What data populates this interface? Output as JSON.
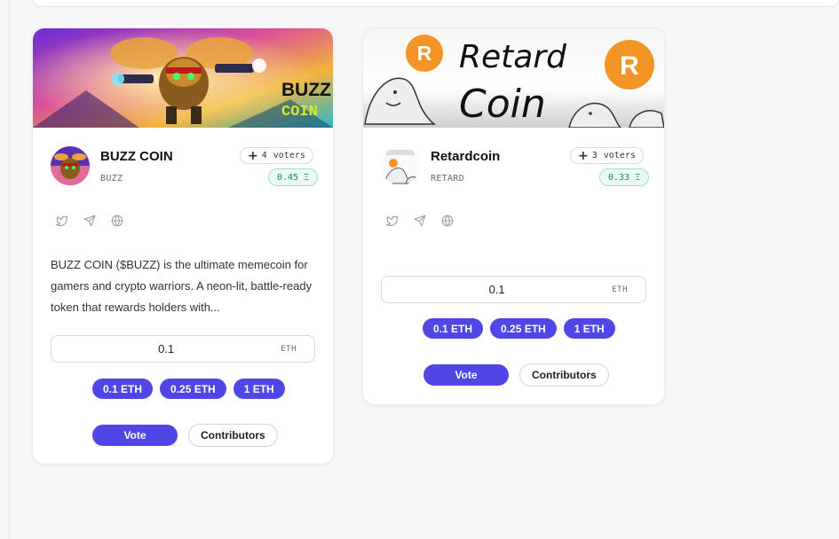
{
  "colors": {
    "accent": "#4f46e5",
    "eth_badge_bg": "#ecfaf4",
    "eth_badge_text": "#1a8a5f"
  },
  "cards": [
    {
      "name": "BUZZ COIN",
      "ticker": "BUZZ",
      "voters_count": "4",
      "voters_label": "voters",
      "eth_total": "0.45 Ξ",
      "banner_text_line1": "BUZZ",
      "banner_text_line2": "COIN",
      "socials": [
        "twitter-icon",
        "telegram-icon",
        "website-icon"
      ],
      "description": "BUZZ COIN ($BUZZ) is the ultimate memecoin for gamers and crypto warriors. A neon-lit, battle-ready token that rewards holders with...",
      "amount_value": "0.1",
      "amount_unit": "ETH",
      "presets": [
        "0.1 ETH",
        "0.25 ETH",
        "1 ETH"
      ],
      "vote_label": "Vote",
      "contributors_label": "Contributors"
    },
    {
      "name": "Retardcoin",
      "ticker": "RETARD",
      "voters_count": "3",
      "voters_label": "voters",
      "eth_total": "0.33 Ξ",
      "banner_text_line1": "Retard",
      "banner_text_line2": "Coin",
      "banner_badge": "R",
      "socials": [
        "twitter-icon",
        "telegram-icon",
        "website-icon"
      ],
      "description": "",
      "amount_value": "0.1",
      "amount_unit": "ETH",
      "presets": [
        "0.1 ETH",
        "0.25 ETH",
        "1 ETH"
      ],
      "vote_label": "Vote",
      "contributors_label": "Contributors"
    }
  ]
}
